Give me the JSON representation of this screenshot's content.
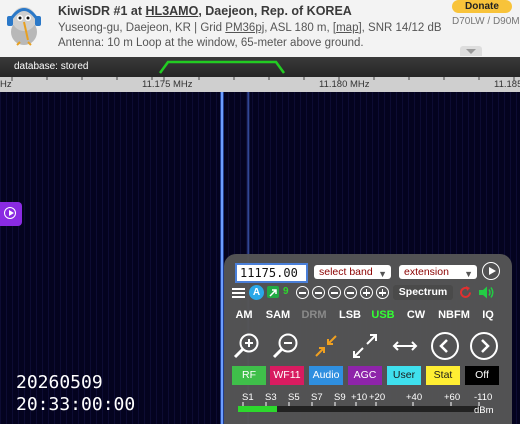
{
  "header": {
    "title_prefix": "KiwiSDR #1 at ",
    "callsign": "HL3AMO",
    "title_suffix": ", Daejeon, Rep. of KOREA",
    "location_prefix": "Yuseong-gu, Daejeon, KR | Grid ",
    "grid": "PM36pj",
    "location_mid": ", ASL 180 m, [",
    "map_link": "map",
    "location_suffix": "], SNR 14/12 dB",
    "antenna": "Antenna: 10 m Loop at the window, 65-meter above ground.",
    "donate_label": "Donate",
    "right_code": "D70LW / D90M"
  },
  "spectrum": {
    "database_status": "database: stored",
    "freq_labels": [
      "Hz",
      "11.175 MHz",
      "11.180 MHz",
      "11.185"
    ],
    "passband_color": "#22cc22"
  },
  "waterfall": {
    "date": "20260509",
    "time": "20:33:00:00"
  },
  "controls": {
    "frequency_value": "11175.00",
    "band_select": "select band",
    "extension_select": "extension",
    "row2": {
      "a_badge": "A",
      "count_badge": "9",
      "spectrum_label": "Spectrum"
    },
    "modes": [
      "AM",
      "SAM",
      "DRM",
      "LSB",
      "USB",
      "CW",
      "NBFM",
      "IQ"
    ],
    "active_mode": "USB",
    "disabled_mode": "DRM",
    "colored_buttons": [
      {
        "label": "RF",
        "bg": "#3fbf4a",
        "fg": "#ffffff"
      },
      {
        "label": "WF11",
        "bg": "#d81b60",
        "fg": "#ffffff"
      },
      {
        "label": "Audio",
        "bg": "#2f8fe0",
        "fg": "#ffffff"
      },
      {
        "label": "AGC",
        "bg": "#8e24aa",
        "fg": "#ffffff"
      },
      {
        "label": "User",
        "bg": "#3fe0ee",
        "fg": "#1a1a1a"
      },
      {
        "label": "Stat",
        "bg": "#ffee33",
        "fg": "#1a1a1a"
      },
      {
        "label": "Off",
        "bg": "#000000",
        "fg": "#ffffff"
      }
    ],
    "smeter": {
      "labels": [
        "S1",
        "S3",
        "S5",
        "S7",
        "S9",
        "+10",
        "+20",
        "+40",
        "+60",
        "-110"
      ],
      "unit": "dBm",
      "level_fraction": 0.16
    }
  },
  "icons": {
    "menu": "hamburger-icon",
    "zoom_in": "zoom-in-icon",
    "zoom_out": "zoom-out-icon",
    "zoom_fit": "compress-icon",
    "zoom_max": "expand-icon",
    "swap": "swap-arrows-icon",
    "prev": "chevron-left-icon",
    "next": "chevron-right-icon",
    "play": "play-icon",
    "refresh": "refresh-icon",
    "volume": "volume-icon"
  },
  "accent_colors": {
    "active_mode": "#33ff33",
    "zoom_fit_arrows": "#f0a020",
    "refresh": "#e03030",
    "volume": "#22cc44",
    "a_badge": "#2aa8e8",
    "count_badge": "#22aa44"
  }
}
